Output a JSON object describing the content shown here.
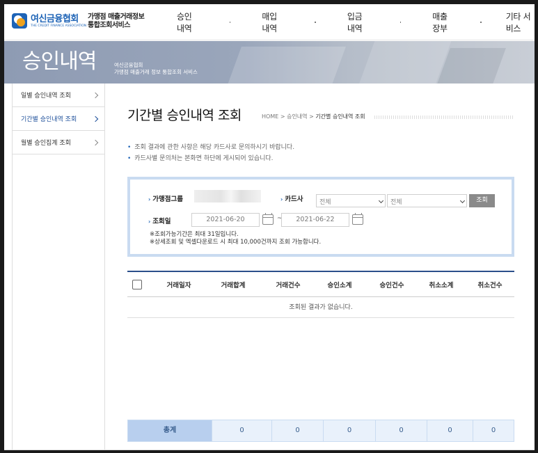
{
  "header": {
    "logo_kr": "여신금융협회",
    "logo_en": "THE CREDIT FINANCE ASSOCIATION",
    "service_line1": "가맹점 매출거래정보",
    "service_line2": "통합조회서비스",
    "nav": [
      "승인내역",
      "매입내역",
      "입금내역",
      "매출장부",
      "기타 서비스"
    ]
  },
  "banner": {
    "title": "승인내역",
    "sub_line1": "여신금융협회",
    "sub_line2": "가맹점 매출거래 정보 통합조회 서비스"
  },
  "sidebar": {
    "items": [
      {
        "label": "일별 승인내역 조회",
        "active": false
      },
      {
        "label": "기간별 승인내역 조회",
        "active": true
      },
      {
        "label": "월별 승인집계 조회",
        "active": false
      }
    ]
  },
  "page": {
    "title": "기간별 승인내역 조회",
    "breadcrumb_home": "HOME",
    "breadcrumb_1": "승인내역",
    "breadcrumb_current": "기간별 승인내역 조회",
    "notice_1": "조회 결과에 관한 사항은 해당 카드사로 문의하시기 바랍니다.",
    "notice_2": "카드사별 문의처는 본화면 하단에 게시되어 있습니다."
  },
  "search": {
    "merchant_group_label": "가맹점그룹",
    "card_label": "카드사",
    "card_select_1": "전체",
    "card_select_2": "전체",
    "search_button": "조회",
    "date_label": "조회일",
    "date_from": "2021-06-20",
    "date_sep": "~",
    "date_to": "2021-06-22",
    "hint_1": "※조회가능기간은 최대 31일입니다.",
    "hint_2": "※상세조회 및 엑셀다운로드 시 최대 10,000건까지 조회 가능합니다."
  },
  "table": {
    "columns": [
      "거래일자",
      "거래합계",
      "거래건수",
      "승인소계",
      "승인건수",
      "취소소계",
      "취소건수"
    ],
    "empty_message": "조회된 결과가 없습니다."
  },
  "totals": {
    "label": "총계",
    "values": [
      "0",
      "0",
      "0",
      "0",
      "0",
      "0"
    ]
  },
  "colors": {
    "brand_blue": "#1d63b6",
    "table_top_border": "#2a4f8a",
    "search_border": "#c9dbf1"
  }
}
